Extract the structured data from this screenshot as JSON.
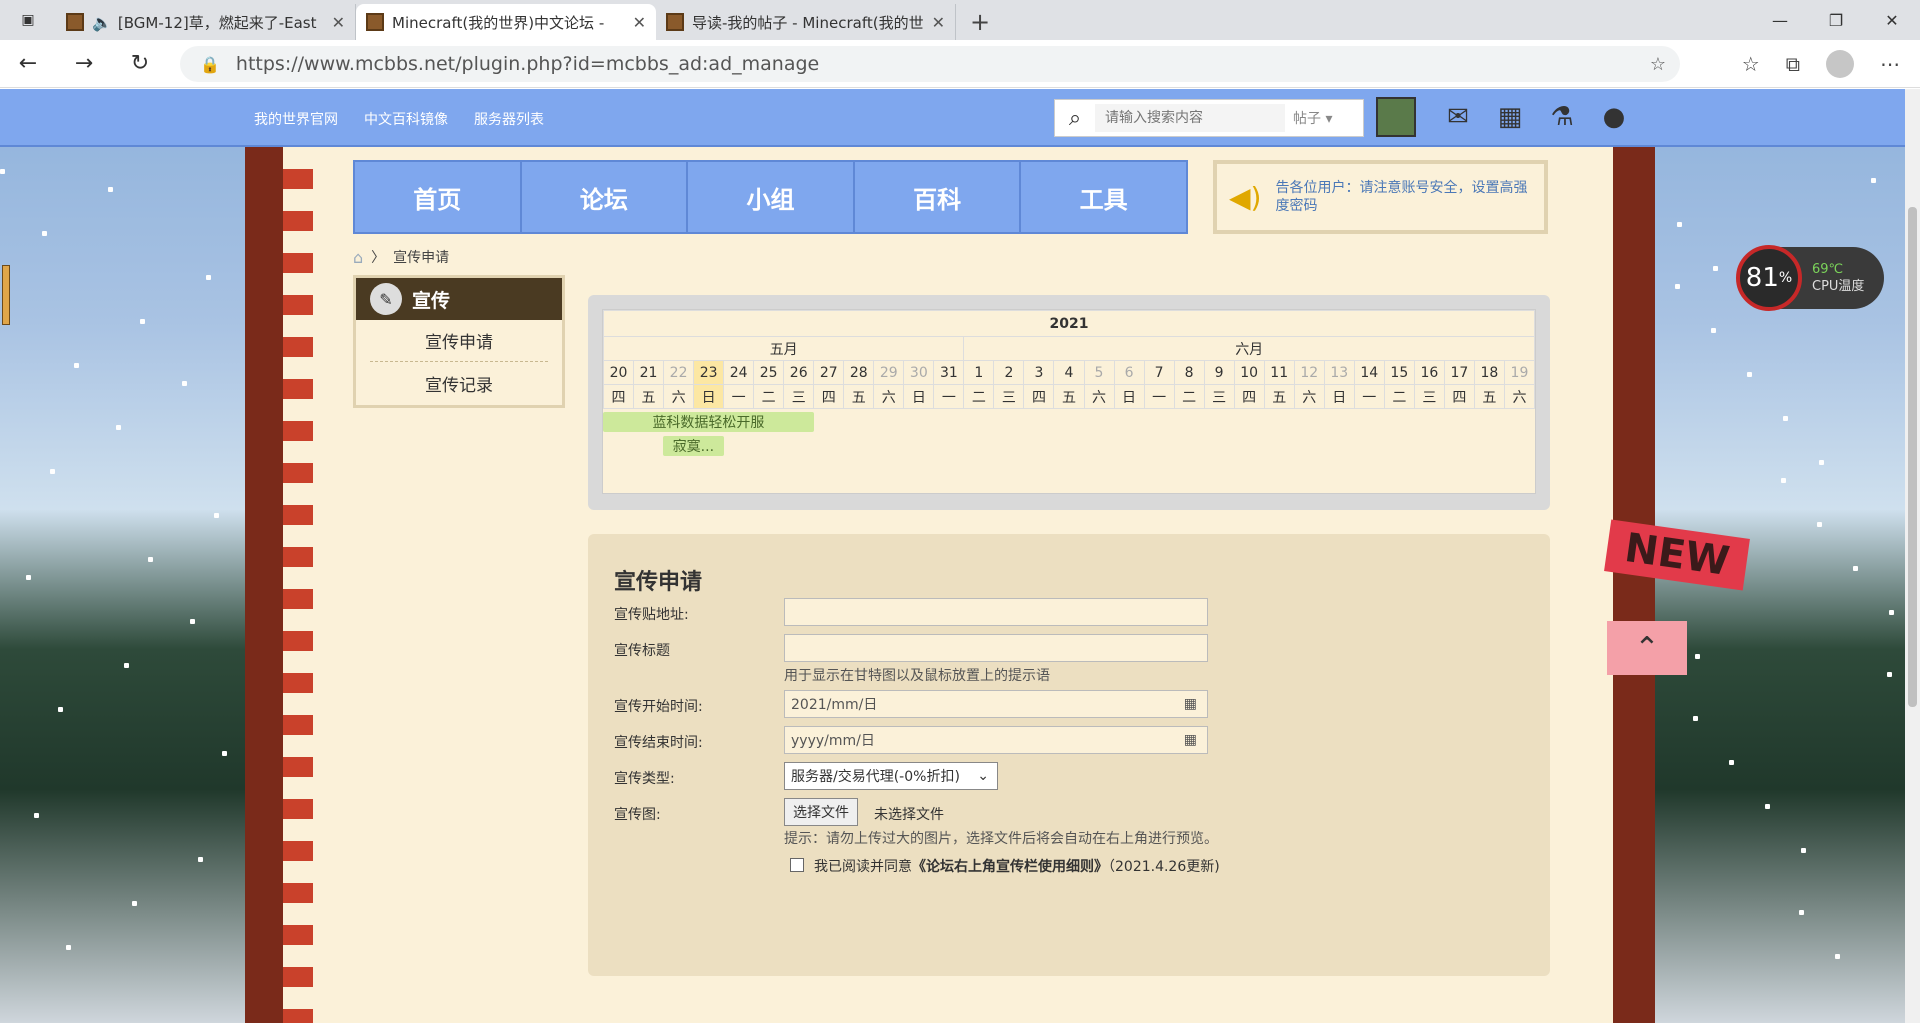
{
  "browser": {
    "tabs": [
      {
        "title": "[BGM-12]草，燃起来了-East",
        "audio": true,
        "active": false
      },
      {
        "title": "Minecraft(我的世界)中文论坛 -",
        "audio": false,
        "active": true
      },
      {
        "title": "导读-我的帖子 - Minecraft(我的世",
        "audio": false,
        "active": false
      }
    ],
    "url": "https://www.mcbbs.net/plugin.php?id=mcbbs_ad:ad_manage"
  },
  "topbar": {
    "links": [
      "我的世界官网",
      "中文百科镜像",
      "服务器列表"
    ],
    "search_placeholder": "请输入搜索内容",
    "search_scope": "帖子"
  },
  "mainnav": [
    "首页",
    "论坛",
    "小组",
    "百科",
    "工具"
  ],
  "notice": "告各位用户：请注意账号安全，设置高强度密码",
  "breadcrumb": {
    "current": "宣传申请"
  },
  "sidebar": {
    "heading": "宣传",
    "items": [
      "宣传申请",
      "宣传记录"
    ]
  },
  "calendar": {
    "year": "2021",
    "months": [
      {
        "label": "五月",
        "span": 12
      },
      {
        "label": "六月",
        "span": 19
      }
    ],
    "days": [
      "20",
      "21",
      "22",
      "23",
      "24",
      "25",
      "26",
      "27",
      "28",
      "29",
      "30",
      "31",
      "1",
      "2",
      "3",
      "4",
      "5",
      "6",
      "7",
      "8",
      "9",
      "10",
      "11",
      "12",
      "13",
      "14",
      "15",
      "16",
      "17",
      "18",
      "19"
    ],
    "weekdays": [
      "四",
      "五",
      "六",
      "日",
      "一",
      "二",
      "三",
      "四",
      "五",
      "六",
      "日",
      "一",
      "二",
      "三",
      "四",
      "五",
      "六",
      "日",
      "一",
      "二",
      "三",
      "四",
      "五",
      "六",
      "日",
      "一",
      "二",
      "三",
      "四",
      "五",
      "六"
    ],
    "weekend_indices": [
      2,
      9,
      10,
      16,
      17,
      23,
      24,
      30
    ],
    "today_index": 3,
    "events": [
      {
        "label": "蓝科数据轻松开服",
        "start": 0,
        "span": 7
      },
      {
        "label": "寂寞...",
        "start": 2,
        "span": 2
      }
    ]
  },
  "form": {
    "title": "宣传申请",
    "fields": {
      "url_label": "宣传贴地址:",
      "title_label": "宣传标题",
      "title_hint": "用于显示在甘特图以及鼠标放置上的提示语",
      "start_label": "宣传开始时间:",
      "start_value": "2021/mm/日",
      "end_label": "宣传结束时间:",
      "end_value": "yyyy/mm/日",
      "type_label": "宣传类型:",
      "type_value": "服务器/交易代理(-0%折扣)",
      "image_label": "宣传图:",
      "file_button": "选择文件",
      "file_status": "未选择文件",
      "image_hint": "提示：请勿上传过大的图片，选择文件后将会自动在右上角进行预览。"
    },
    "agree_prefix": "我已阅读并同意",
    "agree_link": "《论坛右上角宣传栏使用细则》",
    "agree_suffix": "（2021.4.26更新)"
  },
  "cpu_widget": {
    "percent": "81",
    "percent_unit": "%",
    "temp": "69℃",
    "label": "CPU温度"
  },
  "badges": {
    "new": "NEW"
  }
}
